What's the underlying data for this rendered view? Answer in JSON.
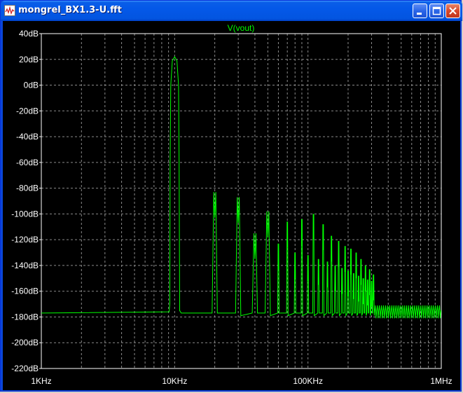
{
  "window": {
    "title": "mongrel_BX1.3-U.fft",
    "controls": {
      "minimize_icon": "minimize-icon",
      "maximize_icon": "maximize-icon",
      "close_icon": "close-icon"
    }
  },
  "chart_data": {
    "type": "line",
    "title": "V(vout)",
    "xlabel": "",
    "ylabel": "",
    "x_scale": "log",
    "xlim_hz": [
      1000,
      1000000
    ],
    "ylim_db": [
      -220,
      40
    ],
    "x_tick_labels": [
      "1KHz",
      "10KHz",
      "100KHz",
      "1MHz"
    ],
    "x_tick_values_hz": [
      1000,
      10000,
      100000,
      1000000
    ],
    "y_tick_labels": [
      "40dB",
      "20dB",
      "0dB",
      "-20dB",
      "-40dB",
      "-60dB",
      "-80dB",
      "-100dB",
      "-120dB",
      "-140dB",
      "-160dB",
      "-180dB",
      "-200dB",
      "-220dB"
    ],
    "y_tick_values_db": [
      40,
      20,
      0,
      -20,
      -40,
      -60,
      -80,
      -100,
      -120,
      -140,
      -160,
      -180,
      -200,
      -220
    ],
    "grid": true,
    "noise_floor_db": -177,
    "series": [
      {
        "name": "V(vout)",
        "color": "#00ff00",
        "fundamental": {
          "freq_hz": 10000,
          "peak_db": 22,
          "base_db": -176
        },
        "harmonics": [
          {
            "freq_hz": 20000,
            "db": -103
          },
          {
            "freq_hz": 30000,
            "db": -107
          },
          {
            "freq_hz": 40000,
            "db": -135
          },
          {
            "freq_hz": 50000,
            "db": -118
          },
          {
            "freq_hz": 60000,
            "db": -143
          },
          {
            "freq_hz": 70000,
            "db": -126
          },
          {
            "freq_hz": 80000,
            "db": -150
          },
          {
            "freq_hz": 90000,
            "db": -124
          },
          {
            "freq_hz": 100000,
            "db": -152
          },
          {
            "freq_hz": 110000,
            "db": -120
          },
          {
            "freq_hz": 120000,
            "db": -155
          },
          {
            "freq_hz": 130000,
            "db": -128
          },
          {
            "freq_hz": 140000,
            "db": -157
          },
          {
            "freq_hz": 150000,
            "db": -137
          },
          {
            "freq_hz": 160000,
            "db": -160
          },
          {
            "freq_hz": 170000,
            "db": -141
          },
          {
            "freq_hz": 180000,
            "db": -162
          },
          {
            "freq_hz": 190000,
            "db": -145
          },
          {
            "freq_hz": 200000,
            "db": -164
          },
          {
            "freq_hz": 210000,
            "db": -147
          },
          {
            "freq_hz": 220000,
            "db": -166
          },
          {
            "freq_hz": 230000,
            "db": -150
          },
          {
            "freq_hz": 240000,
            "db": -168
          },
          {
            "freq_hz": 250000,
            "db": -155
          },
          {
            "freq_hz": 260000,
            "db": -170
          },
          {
            "freq_hz": 270000,
            "db": -160
          },
          {
            "freq_hz": 280000,
            "db": -171
          },
          {
            "freq_hz": 290000,
            "db": -163
          },
          {
            "freq_hz": 300000,
            "db": -172
          },
          {
            "freq_hz": 310000,
            "db": -167
          }
        ]
      }
    ]
  }
}
